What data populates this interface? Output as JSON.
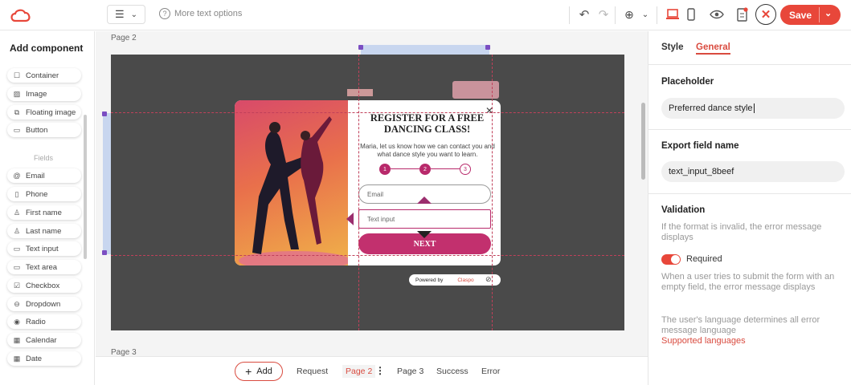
{
  "topbar": {
    "more_text_options": "More text options",
    "save_label": "Save"
  },
  "left_panel": {
    "title": "Add component",
    "components": [
      {
        "label": "Container",
        "icon": "square-icon"
      },
      {
        "label": "Image",
        "icon": "image-icon"
      },
      {
        "label": "Floating image",
        "icon": "floating-image-icon"
      },
      {
        "label": "Button",
        "icon": "button-icon"
      }
    ],
    "fields_label": "Fields",
    "fields": [
      {
        "label": "Email",
        "icon": "at-icon"
      },
      {
        "label": "Phone",
        "icon": "phone-icon"
      },
      {
        "label": "First name",
        "icon": "person-icon"
      },
      {
        "label": "Last name",
        "icon": "person-icon"
      },
      {
        "label": "Text input",
        "icon": "text-input-icon"
      },
      {
        "label": "Text area",
        "icon": "text-area-icon"
      },
      {
        "label": "Checkbox",
        "icon": "checkbox-icon"
      },
      {
        "label": "Dropdown",
        "icon": "dropdown-icon"
      },
      {
        "label": "Radio",
        "icon": "radio-icon"
      },
      {
        "label": "Calendar",
        "icon": "calendar-icon"
      },
      {
        "label": "Date",
        "icon": "date-icon"
      }
    ]
  },
  "canvas": {
    "page2_label": "Page 2",
    "page3_label": "Page 3",
    "popup": {
      "title": "REGISTER FOR A FREE DANCING CLASS!",
      "subtitle": "Maria, let us know how we can contact you and what dance style you want to learn.",
      "steps": [
        "1",
        "2",
        "3"
      ],
      "email_placeholder": "Email",
      "text_input_placeholder": "Text input",
      "next_label": "NEXT",
      "powered_by": "Powered by",
      "brand": "Claspo"
    }
  },
  "bottombar": {
    "add_label": "Add",
    "tabs": [
      "Request",
      "Page 2",
      "Page 3",
      "Success",
      "Error"
    ],
    "active_tab": "Page 2"
  },
  "right_panel": {
    "tabs": [
      "Style",
      "General"
    ],
    "active_tab": "General",
    "placeholder_title": "Placeholder",
    "placeholder_value": "Preferred dance style",
    "export_title": "Export field name",
    "export_value": "text_input_8beef",
    "validation_title": "Validation",
    "validation_desc": "If the format is invalid, the error message displays",
    "required_label": "Required",
    "required_on": true,
    "required_desc": "When a user tries to submit the form with an empty field, the error message displays",
    "language_desc": "The user's language determines all error message language",
    "supported_link": "Supported languages"
  },
  "colors": {
    "accent": "#e8473a",
    "popup_accent": "#c2306e",
    "canvas_dark": "#4a4a4a"
  }
}
